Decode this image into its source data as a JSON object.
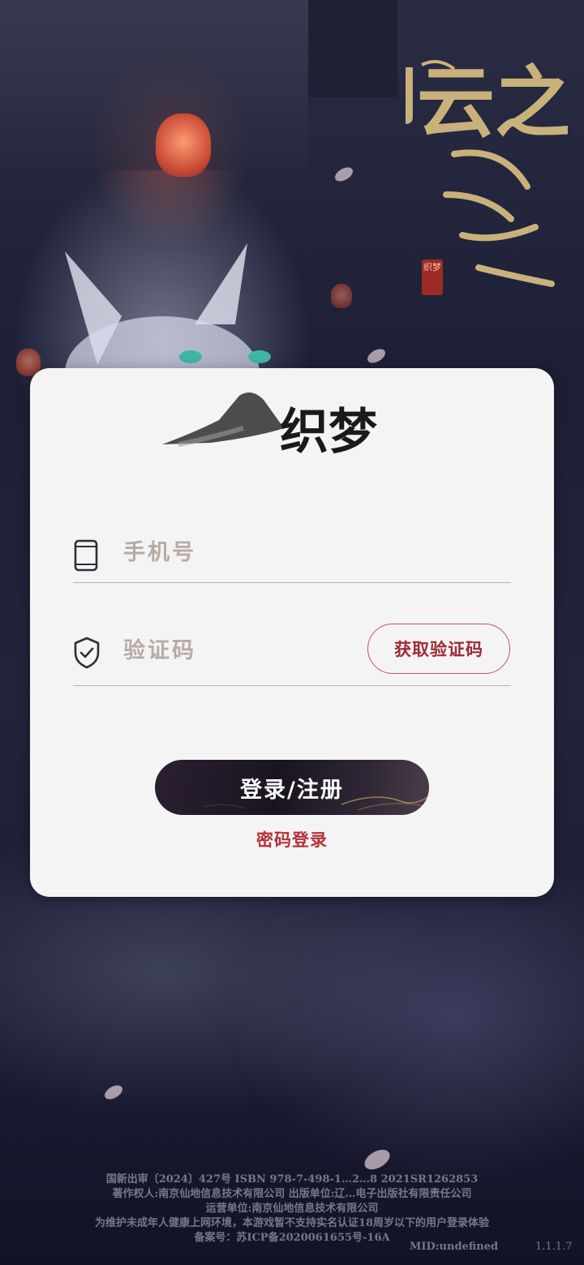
{
  "background": {
    "title_art_text": "卿云之上",
    "seal_text": "织梦"
  },
  "login_card": {
    "logo_text": "织梦",
    "phone_placeholder": "手机号",
    "code_placeholder": "验证码",
    "get_code_label": "获取验证码",
    "login_register_label": "登录/注册",
    "password_login_label": "密码登录"
  },
  "icons": {
    "phone": "phone-icon",
    "shield": "shield-check-icon"
  },
  "colors": {
    "accent_red": "#b2323b",
    "button_dark": "#1a1420",
    "card_bg": "#f5f4f4"
  },
  "footer": {
    "lines": [
      "国新出审〔2024〕427号 ISBN 978-7-498-1…2…8 2021SR1262853",
      "著作权人:南京仙地信息技术有限公司 出版单位:辽…电子出版社有限责任公司",
      "运营单位:南京仙地信息技术有限公司",
      "为维护未成年人健康上网环境，本游戏暂不支持实名认证18周岁以下的用户登录体验",
      "备案号：苏ICP备2020061655号-16A"
    ],
    "mid": "MID:undefined",
    "version": "1.1.1.7"
  }
}
